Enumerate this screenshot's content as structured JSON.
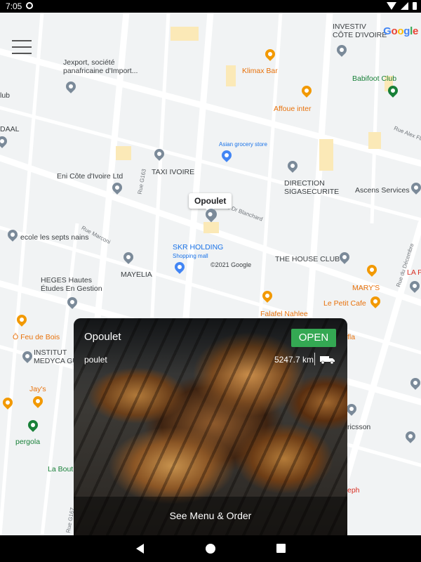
{
  "status_bar": {
    "time": "7:05"
  },
  "map": {
    "attribution": "©2021 Google",
    "logo": "Google",
    "callout": "Opoulet",
    "places": {
      "investiv": "INVESTIV\nCÔTE D'IVOIRE",
      "jexport": "Jexport, société\npanafricaine d'Import...",
      "klimax": "Klimax Bar",
      "babifoot": "Babifoot Club",
      "affoue": "Affoue inter",
      "daal": "DAAL",
      "asian": "Asian grocery store",
      "eni": "Eni Côte d'Ivoire Ltd",
      "taxi": "TAXI IVOIRE",
      "direction": "DIRECTION\nSIGASECURITE",
      "ascens": "Ascens Services",
      "ecole": "ecole les septs nains",
      "skr": "SKR HOLDING",
      "skr_sub": "Shopping mall",
      "mayelia": "MAYELIA",
      "house": "THE HOUSE CLUB",
      "heges": "HEGES Hautes\nÉtudes En Gestion",
      "marys": "MARY'S",
      "lapa": "LA P",
      "petitcafe": "Le Petit Cafe",
      "falafel": "Falafel Nahlee",
      "feudebois": "Ô Feu de Bois",
      "institut": "INSTITUT\nMEDYCA GU",
      "jays": "Jay's",
      "pergola": "pergola",
      "labout": "La Bout",
      "ericsson": "ricsson",
      "eph": "eph",
      "fla": "fla",
      "lub": "lub"
    },
    "roads": {
      "g163": "Rue G163",
      "marconi": "Rue Marconi",
      "blanchard": "au Dr Blanchard",
      "alexfl": "Rue Alex Fle",
      "decembre": "Rue du Décembre",
      "g167": "Rue G167"
    }
  },
  "card": {
    "name": "Opoulet",
    "category": "poulet",
    "status": "OPEN",
    "distance": "5247.7 km",
    "action": "See Menu & Order"
  },
  "colors": {
    "open": "#34a853",
    "map_bg": "#f1f3f4"
  },
  "icons": [
    "menu-icon",
    "delivery-truck-icon",
    "back-icon",
    "home-icon",
    "recents-icon"
  ]
}
